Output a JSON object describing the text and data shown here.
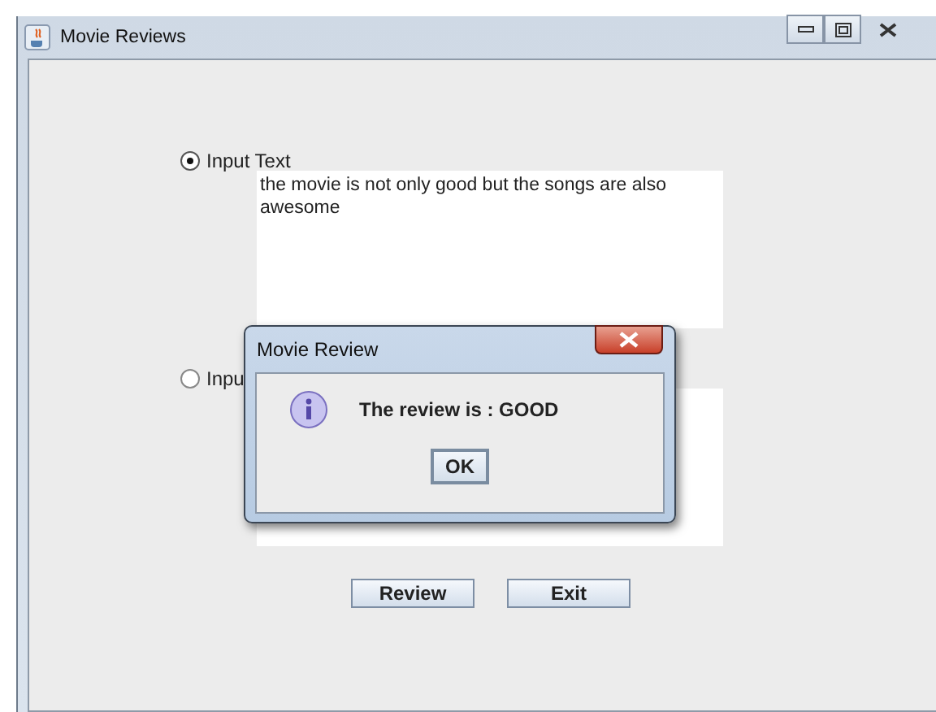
{
  "window": {
    "title": "Movie Reviews"
  },
  "options": [
    {
      "label": "Input Text",
      "selected": true,
      "text": "the movie is not only good but the songs are also awesome"
    },
    {
      "label": "Inpu",
      "selected": false
    }
  ],
  "buttons": [
    "Review",
    "Exit"
  ],
  "dialog": {
    "title": "Movie Review",
    "message": "The review is : GOOD",
    "button": "OK"
  }
}
